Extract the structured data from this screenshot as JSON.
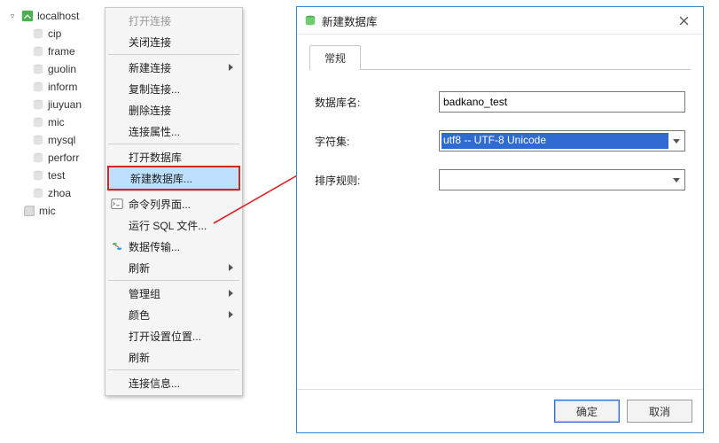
{
  "tree": {
    "connection": "localhost",
    "databases": [
      "cip",
      "frame",
      "guolin",
      "inform",
      "jiuyuan",
      "mic",
      "mysql",
      "perforr",
      "test",
      "zhoa"
    ],
    "mic": "mic"
  },
  "menu": {
    "open_conn": "打开连接",
    "close_conn": "关闭连接",
    "new_conn": "新建连接",
    "dup_conn": "复制连接...",
    "del_conn": "删除连接",
    "conn_props": "连接属性...",
    "open_db": "打开数据库",
    "new_db": "新建数据库...",
    "cli": "命令列界面...",
    "run_sql": "运行 SQL 文件...",
    "data_transfer": "数据传输...",
    "refresh1": "刷新",
    "manage_group": "管理组",
    "color": "颜色",
    "open_settings": "打开设置位置...",
    "refresh2": "刷新",
    "conn_info": "连接信息..."
  },
  "dialog": {
    "title": "新建数据库",
    "tab_general": "常规",
    "label_dbname": "数据库名:",
    "value_dbname": "badkano_test",
    "label_charset": "字符集:",
    "value_charset": "utf8 -- UTF-8 Unicode",
    "label_collation": "排序规则:",
    "value_collation": "",
    "btn_ok": "确定",
    "btn_cancel": "取消"
  }
}
